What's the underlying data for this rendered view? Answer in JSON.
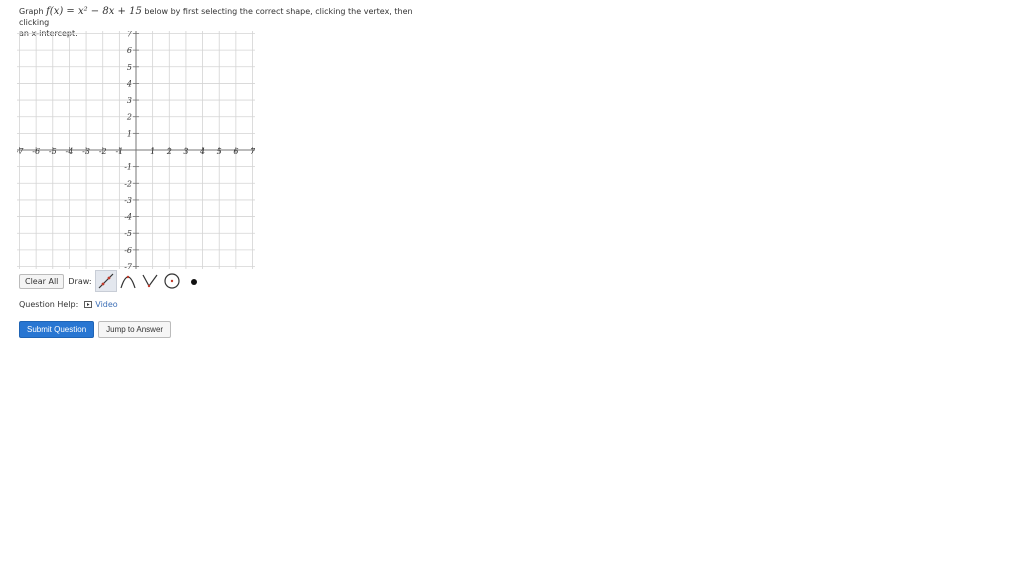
{
  "prompt": {
    "prefix": "Graph",
    "math_f": "f(x) = x² − 8x + 15",
    "suffix": "below by first selecting the correct shape, clicking the vertex, then clicking",
    "line2": "an x-intercept."
  },
  "graph": {
    "x_ticks": [
      "-7",
      "-6",
      "-5",
      "-4",
      "-3",
      "-2",
      "-1",
      "1",
      "2",
      "3",
      "4",
      "5",
      "6",
      "7"
    ],
    "x_tick_values": [
      -7,
      -6,
      -5,
      -4,
      -3,
      -2,
      -1,
      1,
      2,
      3,
      4,
      5,
      6,
      7
    ],
    "y_ticks": [
      "7",
      "6",
      "5",
      "4",
      "3",
      "2",
      "1",
      "-1",
      "-2",
      "-3",
      "-4",
      "-5",
      "-6",
      "-7"
    ],
    "y_tick_values": [
      7,
      6,
      5,
      4,
      3,
      2,
      1,
      -1,
      -2,
      -3,
      -4,
      -5,
      -6,
      -7
    ],
    "x_range": [
      -7,
      7
    ],
    "y_range": [
      -7,
      7
    ],
    "grid": true,
    "grid_color": "#d4d4d4",
    "axis_color": "#777777"
  },
  "toolbar": {
    "clear_label": "Clear All",
    "draw_label": "Draw:",
    "tools": [
      {
        "name": "line-tool",
        "icon": "line-icon",
        "selected": true
      },
      {
        "name": "parabola-down-tool",
        "icon": "parabola-down-icon",
        "selected": false
      },
      {
        "name": "absolute-value-tool",
        "icon": "absolute-value-icon",
        "selected": false
      },
      {
        "name": "circle-tool",
        "icon": "circle-icon",
        "selected": false
      },
      {
        "name": "point-tool",
        "icon": "point-icon",
        "selected": false
      }
    ],
    "accent": "#c0392b"
  },
  "help": {
    "label": "Question Help:",
    "video_label": "Video"
  },
  "actions": {
    "submit_label": "Submit Question",
    "jump_label": "Jump to Answer",
    "submit_color": "#2876d2"
  }
}
